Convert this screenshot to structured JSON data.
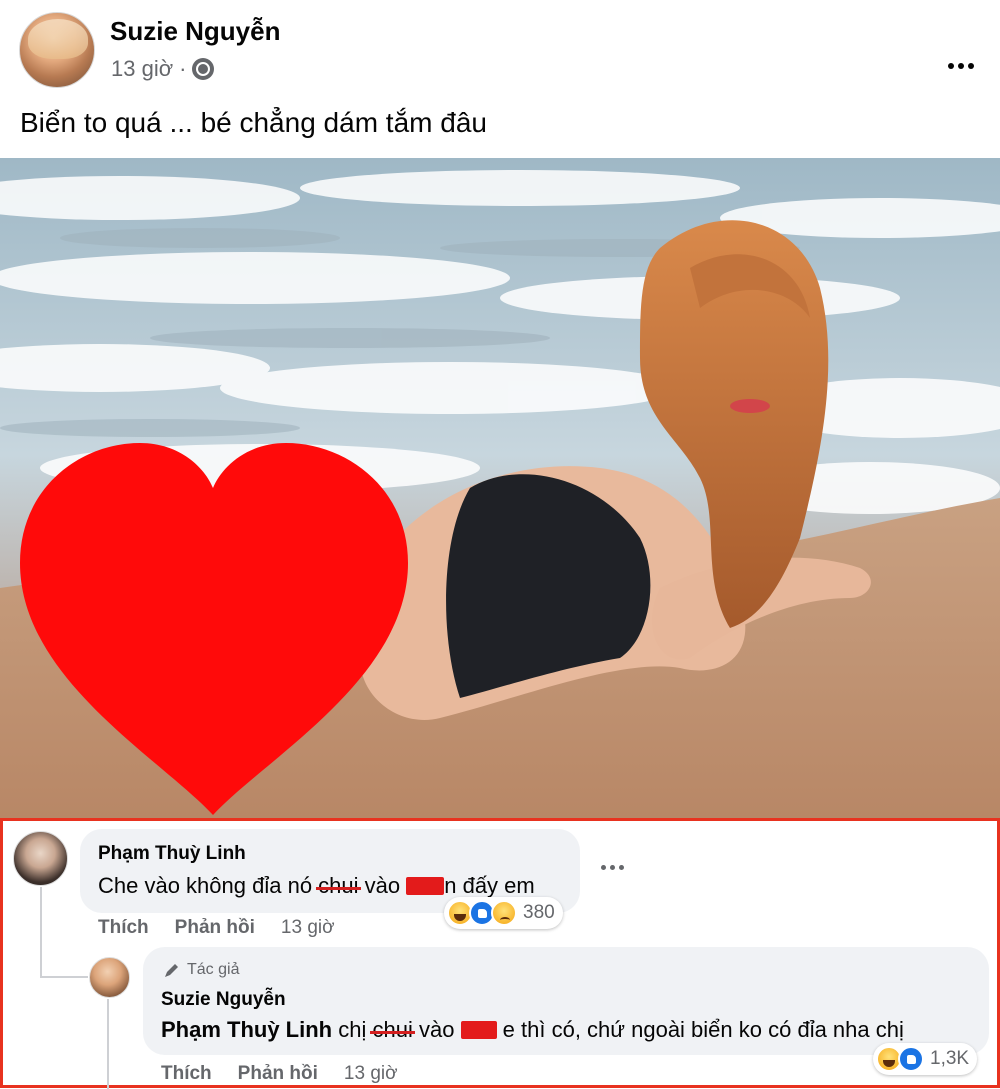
{
  "post": {
    "author": "Suzie Nguyễn",
    "time": "13 giờ",
    "separator": "·",
    "caption": "Biển to quá ... bé chẳng dám tắm đâu",
    "more_icon": "more-horizontal-icon",
    "privacy_icon": "globe-icon"
  },
  "comments": [
    {
      "name": "Phạm Thuỳ Linh",
      "text_part1": "Che vào không đỉa nó ",
      "text_struck": "chui",
      "text_part2": " vào ",
      "text_part3": "n đấy em",
      "reaction_count": "380",
      "reactions": [
        "haha-icon",
        "like-icon",
        "sad-icon"
      ],
      "actions": {
        "like": "Thích",
        "reply": "Phản hồi",
        "time": "13 giờ"
      }
    },
    {
      "badge": "Tác giả",
      "name": "Suzie Nguyễn",
      "mention": "Phạm Thuỳ Linh",
      "text_part1": " chị ",
      "text_struck": "chui",
      "text_part2": " vào ",
      "text_part3": " e thì có, chứ ngoài biển ko có đỉa nha chị",
      "reaction_count": "1,3K",
      "reactions": [
        "haha-icon",
        "like-icon"
      ],
      "actions": {
        "like": "Thích",
        "reply": "Phản hồi",
        "time": "13 giờ"
      }
    }
  ],
  "colors": {
    "highlight_border": "#e8321f",
    "redaction": "#e31b1b",
    "heart_overlay": "#ff0a0a",
    "bubble_bg": "#f0f2f5",
    "secondary_text": "#65676b"
  }
}
